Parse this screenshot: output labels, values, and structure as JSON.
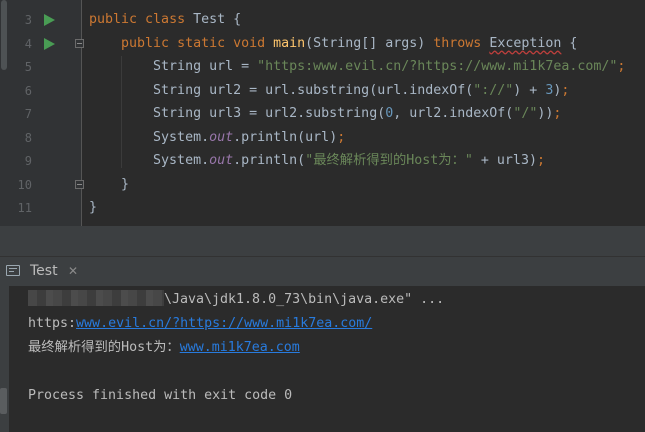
{
  "editor": {
    "lines": [
      {
        "number": "3",
        "tokens": [
          {
            "t": "public ",
            "c": "kw"
          },
          {
            "t": "class ",
            "c": "kw"
          },
          {
            "t": "Test {",
            "c": "plain"
          }
        ]
      },
      {
        "number": "4",
        "tokens": [
          {
            "t": "    public ",
            "c": "kw"
          },
          {
            "t": "static ",
            "c": "kw"
          },
          {
            "t": "void ",
            "c": "kw"
          },
          {
            "t": "main",
            "c": "fn"
          },
          {
            "t": "(String[] args) ",
            "c": "plain"
          },
          {
            "t": "throws ",
            "c": "kw"
          },
          {
            "t": "Exception",
            "c": "exc"
          },
          {
            "t": " {",
            "c": "plain"
          }
        ]
      },
      {
        "number": "5",
        "tokens": [
          {
            "t": "        String url = ",
            "c": "plain"
          },
          {
            "t": "\"https:www.evil.cn/?https://www.mi1k7ea.com/\"",
            "c": "str"
          },
          {
            "t": ";",
            "c": "kw"
          }
        ]
      },
      {
        "number": "6",
        "tokens": [
          {
            "t": "        String url2 = url.substring(url.indexOf(",
            "c": "plain"
          },
          {
            "t": "\"://\"",
            "c": "str"
          },
          {
            "t": ") + ",
            "c": "plain"
          },
          {
            "t": "3",
            "c": "num"
          },
          {
            "t": ")",
            "c": "plain"
          },
          {
            "t": ";",
            "c": "kw"
          }
        ]
      },
      {
        "number": "7",
        "tokens": [
          {
            "t": "        String url3 = url2.substring(",
            "c": "plain"
          },
          {
            "t": "0",
            "c": "num"
          },
          {
            "t": ", url2.indexOf(",
            "c": "plain"
          },
          {
            "t": "\"/\"",
            "c": "str"
          },
          {
            "t": "))",
            "c": "plain"
          },
          {
            "t": ";",
            "c": "kw"
          }
        ]
      },
      {
        "number": "8",
        "tokens": [
          {
            "t": "        System.",
            "c": "plain"
          },
          {
            "t": "out",
            "c": "fld"
          },
          {
            "t": ".println(url)",
            "c": "plain"
          },
          {
            "t": ";",
            "c": "kw"
          }
        ]
      },
      {
        "number": "9",
        "tokens": [
          {
            "t": "        System.",
            "c": "plain"
          },
          {
            "t": "out",
            "c": "fld"
          },
          {
            "t": ".println(",
            "c": "plain"
          },
          {
            "t": "\"最终解析得到的Host为：\"",
            "c": "str"
          },
          {
            "t": " + url3)",
            "c": "plain"
          },
          {
            "t": ";",
            "c": "kw"
          }
        ]
      },
      {
        "number": "10",
        "tokens": [
          {
            "t": "    }",
            "c": "plain"
          }
        ]
      },
      {
        "number": "11",
        "tokens": [
          {
            "t": "}",
            "c": "plain"
          }
        ]
      }
    ]
  },
  "run_panel": {
    "tab_label": "Test",
    "close_glyph": "✕"
  },
  "console": {
    "command_suffix": "\\Java\\jdk1.8.0_73\\bin\\java.exe\" ...",
    "line1_prefix": "https:",
    "line1_link": "www.evil.cn/?https://www.mi1k7ea.com/",
    "line2_prefix": "最终解析得到的Host为：",
    "line2_link": "www.mi1k7ea.com",
    "exit_message": "Process finished with exit code 0"
  },
  "colors": {
    "background": "#2b2b2b",
    "keyword": "#cc7832",
    "string": "#6a8759",
    "number": "#6897bb",
    "method": "#ffc66d",
    "static_field": "#9876aa",
    "link": "#287bde",
    "run_icon": "#499c54"
  },
  "icons": {
    "run_gutter": "run-triangle-icon",
    "fold": "fold-icon",
    "console_tab": "console-icon",
    "close": "close-icon"
  }
}
